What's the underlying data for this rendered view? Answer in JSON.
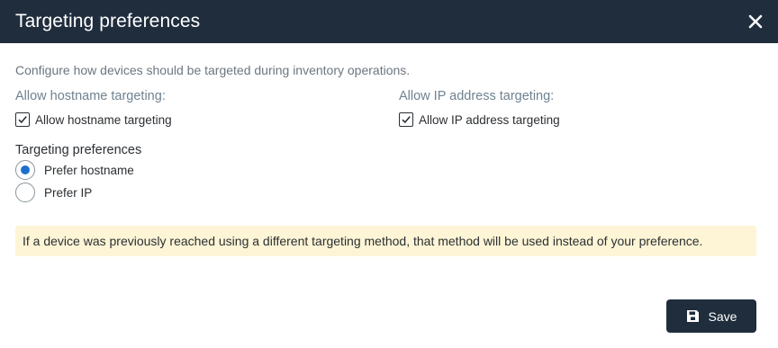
{
  "dialog": {
    "title": "Targeting preferences",
    "description": "Configure how devices should be targeted during inventory operations."
  },
  "hostname": {
    "label": "Allow hostname targeting:",
    "checkbox_label": "Allow hostname targeting",
    "checked": true
  },
  "ip": {
    "label": "Allow IP address targeting:",
    "checkbox_label": "Allow IP address targeting",
    "checked": true
  },
  "preferences": {
    "label": "Targeting preferences",
    "options": [
      {
        "label": "Prefer hostname",
        "selected": true
      },
      {
        "label": "Prefer IP",
        "selected": false
      }
    ]
  },
  "notice": {
    "text": "If a device was previously reached using a different targeting method, that method will be used instead of your preference."
  },
  "footer": {
    "save_label": "Save"
  },
  "colors": {
    "header_bg": "#1f2d3d",
    "notice_bg": "#fdf5d6",
    "radio_accent": "#1f6fd1"
  },
  "icons": {
    "close": "close-icon",
    "save": "save-icon",
    "check": "check-icon"
  }
}
